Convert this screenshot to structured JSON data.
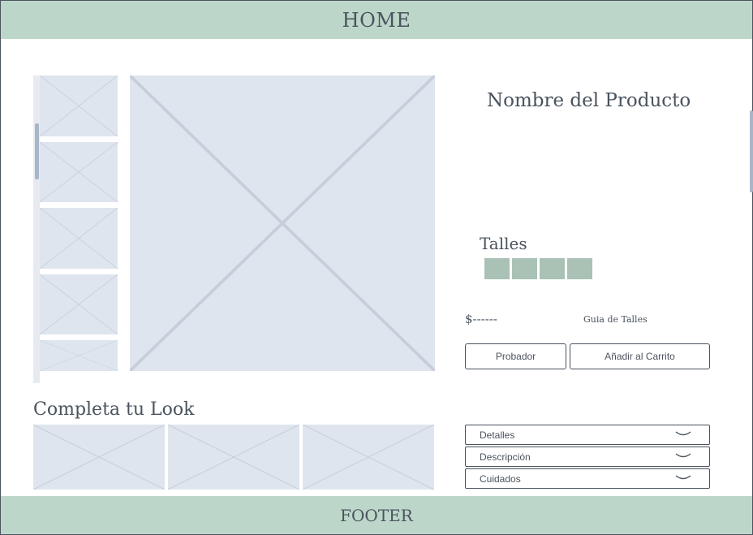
{
  "header": {
    "label": "HOME"
  },
  "footer": {
    "label": "FOOTER"
  },
  "product": {
    "name": "Nombre del Producto",
    "sizes_label": "Talles",
    "sizes": [
      "",
      "",
      "",
      ""
    ],
    "price": "$------",
    "size_guide": "Guia de Talles"
  },
  "buttons": {
    "try_on": "Probador",
    "add_to_cart": "Añadir al Carrito"
  },
  "look": {
    "title": "Completa tu Look"
  },
  "accordion": [
    {
      "label": "Detalles",
      "icon": "chevron-down-icon"
    },
    {
      "label": "Descripción",
      "icon": "chevron-down-icon"
    },
    {
      "label": "Cuidados",
      "icon": "chevron-down-icon"
    }
  ],
  "colors": {
    "bar": "#bcd7c9",
    "size_swatch": "#a9c2b5",
    "placeholder": "#dfe5ee",
    "text": "#4a535e"
  }
}
